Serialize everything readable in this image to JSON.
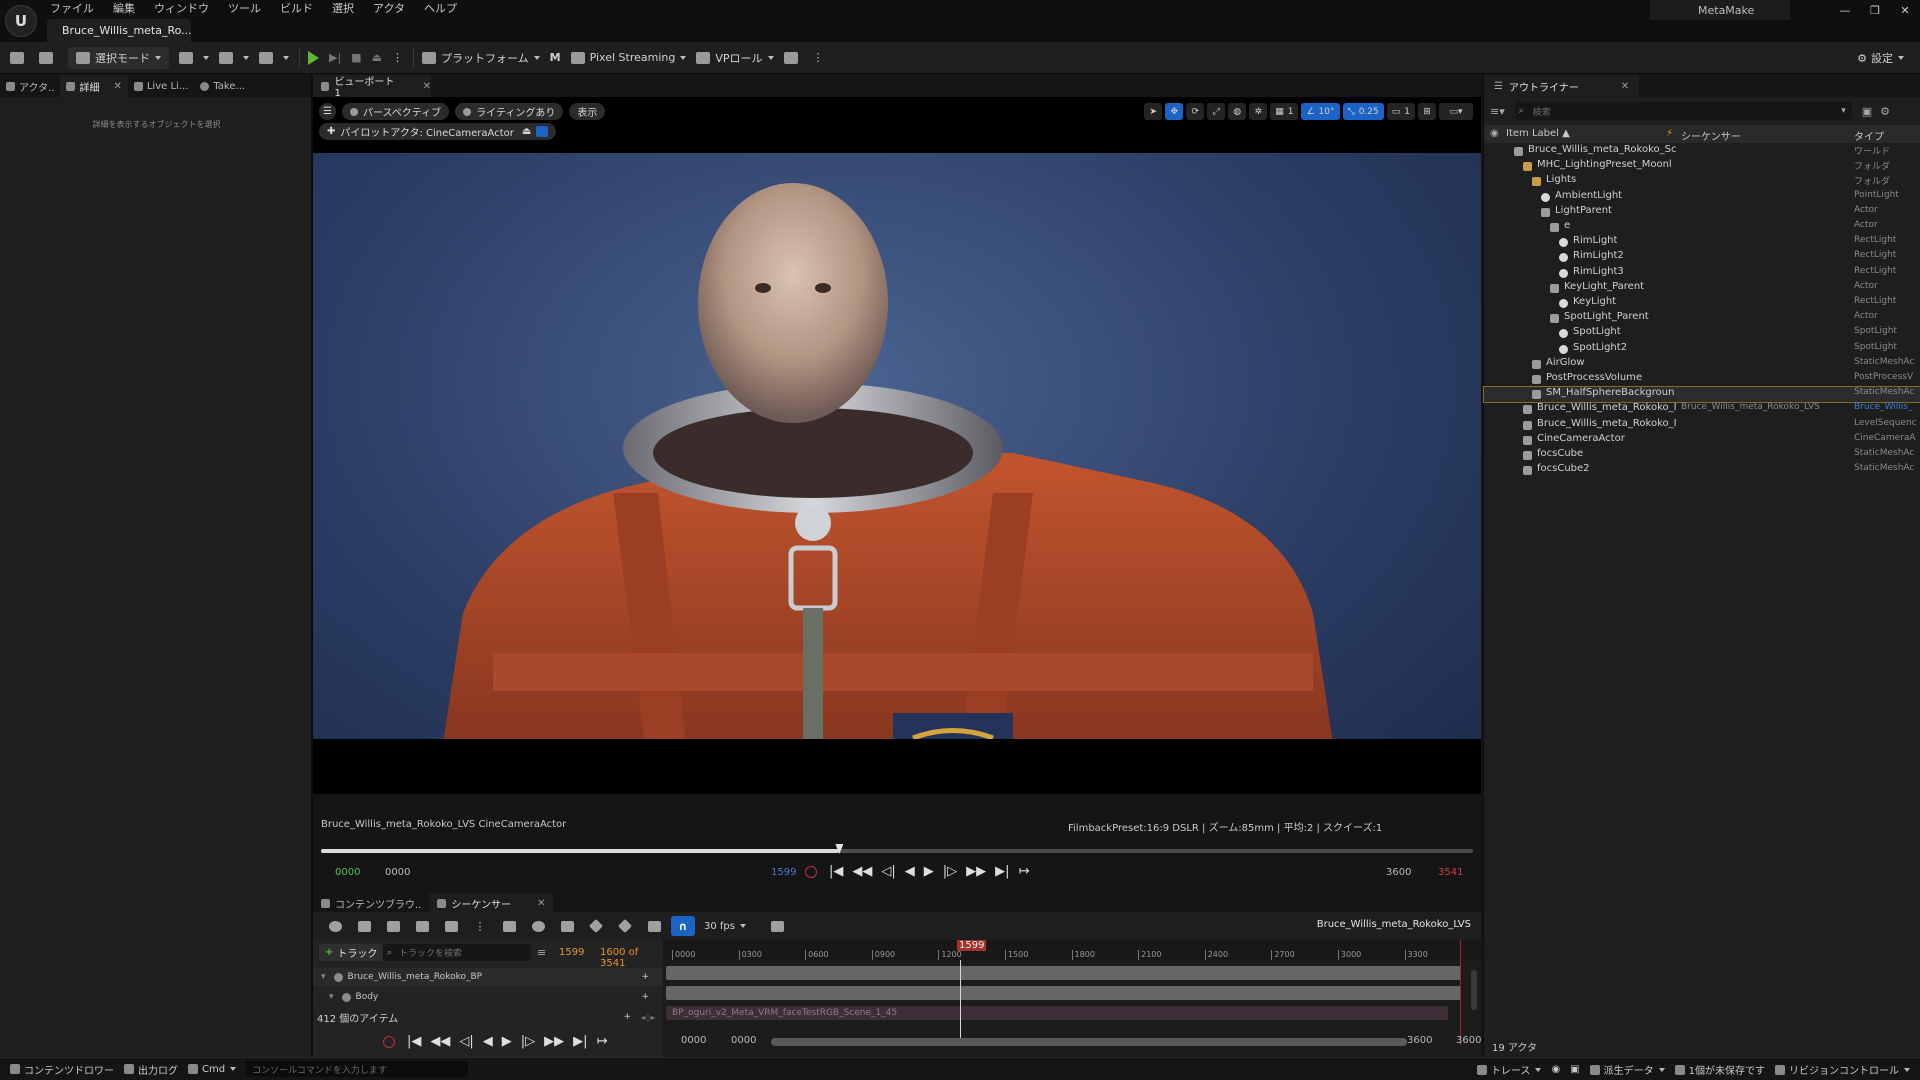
{
  "menu": [
    "ファイル",
    "編集",
    "ウィンドウ",
    "ツール",
    "ビルド",
    "選択",
    "アクタ",
    "ヘルプ"
  ],
  "doc_tab": "Bruce_Willis_meta_Ro...",
  "project": "MetaMake",
  "toolbar": {
    "select_mode": "選択モード",
    "platform": "プラットフォーム",
    "pixel_streaming": "Pixel Streaming",
    "vp_role": "VPロール",
    "settings": "設定"
  },
  "left_tabs": [
    "アクタ..",
    "詳細",
    "Live Li...",
    "Take..."
  ],
  "details_empty": "詳細を表示するオブジェクトを選択",
  "viewport": {
    "tab": "ビューポート1",
    "perspective": "パースペクティブ",
    "lighting": "ライティングあり",
    "show": "表示",
    "pilot": "パイロットアクタ: CineCameraActor",
    "grid": "1",
    "angle": "10°",
    "scale": "0.25",
    "cam_speed": "1",
    "info_left": "Bruce_Willis_meta_Rokoko_LVS CineCameraActor",
    "info_center": "FilmbackPreset:16:9 DSLR | ズーム:85mm | 平均:2 | スクイーズ:1",
    "frame": "1599"
  },
  "playback": {
    "start_green": "0000",
    "start": "0000",
    "current": "1599",
    "end": "3600",
    "end_red": "3541",
    "progress": 0.45
  },
  "sequencer": {
    "tabs": [
      "コンテンツブラウ..",
      "シーケンサー"
    ],
    "fps": "30 fps",
    "sequence_name": "Bruce_Willis_meta_Rokoko_LVS",
    "track_button": "トラック",
    "track_search": "トラックを検索",
    "current_frame": "1599",
    "count": "1600 of 3541",
    "tracks": [
      "Bruce_Willis_meta_Rokoko_BP",
      "Body"
    ],
    "items": "412 個のアイテム",
    "clip": "BP_oguri_v2_Meta_VRM_faceTestRGB_Scene_1_45",
    "ticks": [
      "0000",
      "0300",
      "0600",
      "0900",
      "1200",
      "1500",
      "1800",
      "2100",
      "2400",
      "2700",
      "3000",
      "3300"
    ],
    "playhead": "1599",
    "bottom_nums": [
      "0000",
      "0000",
      "3600",
      "3600"
    ]
  },
  "outliner": {
    "tab": "アウトライナー",
    "search": "検索",
    "col_label": "Item Label ▲",
    "col_seq": "シーケンサー",
    "col_type": "タイプ",
    "rows": [
      {
        "name": "Bruce_Willis_meta_Rokoko_Sc",
        "type": "ワールド",
        "depth": 0,
        "icon": "world"
      },
      {
        "name": "MHC_LightingPreset_Moonl",
        "type": "フォルダ",
        "depth": 1,
        "icon": "folder"
      },
      {
        "name": "Lights",
        "type": "フォルダ",
        "depth": 2,
        "icon": "folder"
      },
      {
        "name": "AmbientLight",
        "type": "PointLight",
        "depth": 3,
        "icon": "light"
      },
      {
        "name": "LightParent",
        "type": "Actor",
        "depth": 3,
        "icon": "actor"
      },
      {
        "name": "e",
        "type": "Actor",
        "depth": 4,
        "icon": "actor"
      },
      {
        "name": "RimLight",
        "type": "RectLight",
        "depth": 5,
        "icon": "light"
      },
      {
        "name": "RimLight2",
        "type": "RectLight",
        "depth": 5,
        "icon": "light"
      },
      {
        "name": "RimLight3",
        "type": "RectLight",
        "depth": 5,
        "icon": "light"
      },
      {
        "name": "KeyLight_Parent",
        "type": "Actor",
        "depth": 4,
        "icon": "actor"
      },
      {
        "name": "KeyLight",
        "type": "RectLight",
        "depth": 5,
        "icon": "light"
      },
      {
        "name": "SpotLight_Parent",
        "type": "Actor",
        "depth": 4,
        "icon": "actor"
      },
      {
        "name": "SpotLight",
        "type": "SpotLight",
        "depth": 5,
        "icon": "light"
      },
      {
        "name": "SpotLight2",
        "type": "SpotLight",
        "depth": 5,
        "icon": "light"
      },
      {
        "name": "AirGlow",
        "type": "StaticMeshAc",
        "depth": 2,
        "icon": "mesh"
      },
      {
        "name": "PostProcessVolume",
        "type": "PostProcessV",
        "depth": 2,
        "icon": "mesh"
      },
      {
        "name": "SM_HalfSphereBackgroun",
        "type": "StaticMeshAc",
        "depth": 2,
        "icon": "mesh",
        "selected": true
      },
      {
        "name": "Bruce_Willis_meta_Rokoko_I",
        "seq": "Bruce_Willis_meta_Rokoko_LVS",
        "type": "Bruce_Willis_",
        "depth": 1,
        "icon": "actor"
      },
      {
        "name": "Bruce_Willis_meta_Rokoko_I",
        "type": "LevelSequenc",
        "depth": 1,
        "icon": "mesh"
      },
      {
        "name": "CineCameraActor",
        "type": "CineCameraA",
        "depth": 1,
        "icon": "camera"
      },
      {
        "name": "focsCube",
        "type": "StaticMeshAc",
        "depth": 1,
        "icon": "mesh"
      },
      {
        "name": "focsCube2",
        "type": "StaticMeshAc",
        "depth": 1,
        "icon": "mesh"
      }
    ],
    "count": "19 アクタ"
  },
  "status": {
    "content_drawer": "コンテンツドロワー",
    "output_log": "出力ログ",
    "cmd": "Cmd",
    "console_placeholder": "コンソールコマンドを入力します",
    "trace": "トレース",
    "derived": "派生データ",
    "unsaved": "1個が未保存です",
    "revision": "リビジョンコントロール"
  },
  "colors": {
    "accent_blue": "#1b63c4",
    "play_green": "#5cb82f",
    "frame_orange": "#e8952a",
    "end_red": "#d43c3c",
    "suit_orange": "#c2552e",
    "background_blue": "#2c3e66"
  }
}
